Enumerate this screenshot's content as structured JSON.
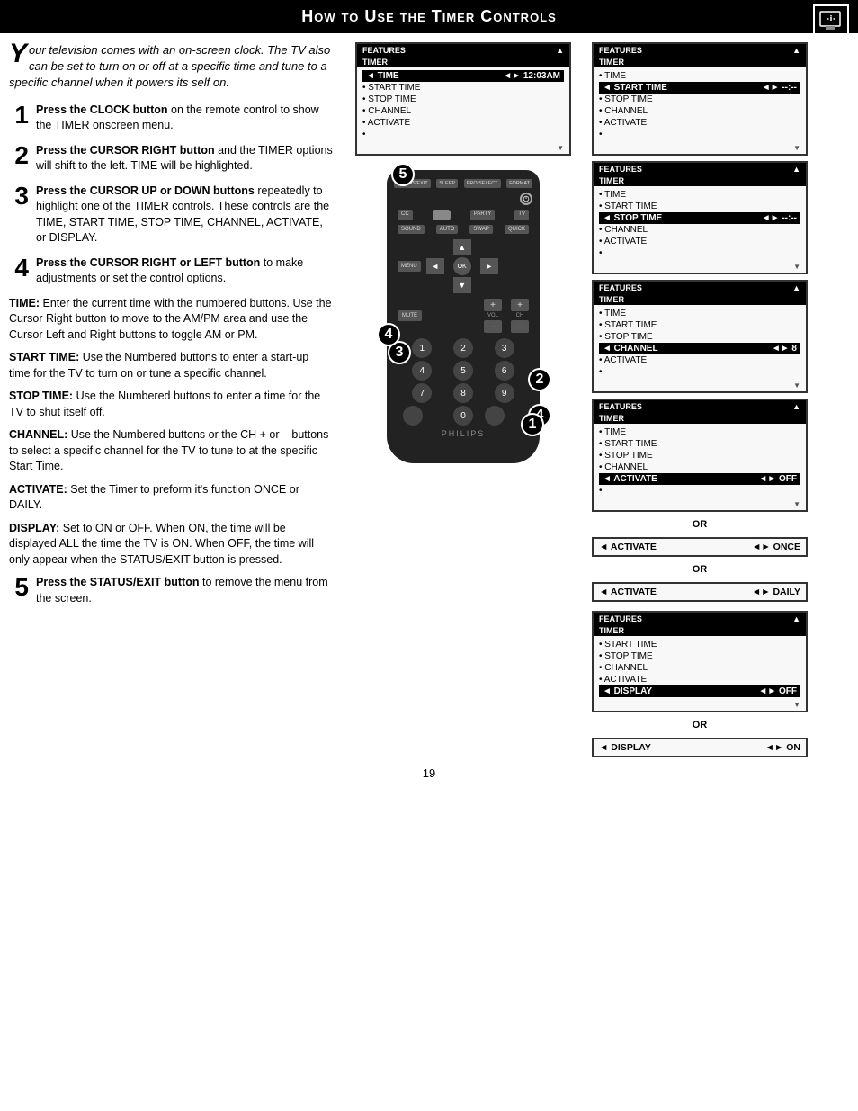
{
  "header": {
    "title": "How to Use the Timer Controls"
  },
  "intro": {
    "drop_cap": "Y",
    "text": "our television comes with an on-screen clock. The TV also can be set to turn on or off at a specific time and tune to a specific channel when it powers its self on."
  },
  "steps": [
    {
      "number": "1",
      "bold": "Press the CLOCK button",
      "text": " on the remote control to show the TIMER onscreen menu."
    },
    {
      "number": "2",
      "bold": "Press the CURSOR RIGHT button",
      "text": " and the TIMER options will shift to the left. TIME will be highlighted."
    },
    {
      "number": "3",
      "bold": "Press the CURSOR UP or DOWN buttons",
      "text": " repeatedly to highlight one of the TIMER controls. These controls are the TIME, START TIME, STOP TIME, CHANNEL, ACTIVATE, or DISPLAY."
    },
    {
      "number": "4",
      "bold": "Press the CURSOR RIGHT or LEFT button",
      "text": " to make adjustments or set the control options."
    }
  ],
  "descriptions": [
    {
      "label": "TIME:",
      "text": "Enter the current time with the numbered buttons. Use the Cursor Right button to move to the AM/PM area and use the Cursor Left and Right buttons to toggle AM or PM."
    },
    {
      "label": "START TIME:",
      "text": "Use the Numbered buttons to enter a start-up time for the TV to turn on or tune a specific channel."
    },
    {
      "label": "STOP TIME:",
      "text": "Use the Numbered buttons to enter a time for the TV to shut itself off."
    },
    {
      "label": "CHANNEL:",
      "text": "Use the Numbered buttons or the CH + or – buttons to select a specific channel for the TV to tune to at the specific Start Time."
    },
    {
      "label": "ACTIVATE:",
      "text": "Set the Timer to preform it's function ONCE or DAILY."
    },
    {
      "label": "DISPLAY:",
      "text": "Set to ON or OFF. When ON, the time will be displayed ALL the time the TV is ON. When OFF, the time will only appear when the STATUS/EXIT button is pressed."
    }
  ],
  "step5": {
    "number": "5",
    "bold": "Press the STATUS/EXIT button",
    "text": " to remove the menu from the screen."
  },
  "screens": {
    "screen1": {
      "header_left": "FEATURES",
      "header_arrow": "▲",
      "sub": "TIMER",
      "highlighted": "◄ TIME",
      "highlighted_right": "◄► 12:03AM",
      "items": [
        "• START TIME",
        "• STOP TIME",
        "• CHANNEL",
        "• ACTIVATE",
        "•"
      ],
      "footer": "▼"
    },
    "screen2": {
      "header_left": "FEATURES",
      "header_arrow": "▲",
      "sub": "TIMER",
      "items": [
        "• TIME"
      ],
      "highlighted": "◄ START TIME",
      "highlighted_right": "◄► --:--",
      "items2": [
        "• STOP TIME",
        "• CHANNEL",
        "• ACTIVATE",
        "•"
      ],
      "footer": "▼"
    },
    "screen3": {
      "header_left": "FEATURES",
      "header_arrow": "▲",
      "sub": "TIMER",
      "items": [
        "• TIME",
        "• START TIME"
      ],
      "highlighted": "◄ STOP TIME",
      "highlighted_right": "◄► --:--",
      "items2": [
        "• CHANNEL",
        "• ACTIVATE",
        "•"
      ],
      "footer": "▼"
    },
    "screen4": {
      "header_left": "FEATURES",
      "header_arrow": "▲",
      "sub": "TIMER",
      "items": [
        "• TIME",
        "• START TIME",
        "• STOP TIME"
      ],
      "highlighted": "◄ CHANNEL",
      "highlighted_right": "◄► 8",
      "items2": [
        "• ACTIVATE",
        "•"
      ],
      "footer": "▼"
    },
    "screen5": {
      "header_left": "FEATURES",
      "header_arrow": "▲",
      "sub": "TIMER",
      "items": [
        "• TIME",
        "• START TIME",
        "• STOP TIME",
        "• CHANNEL"
      ],
      "highlighted": "◄ ACTIVATE",
      "highlighted_right": "◄► OFF",
      "items2": [
        "•"
      ],
      "footer": "▼"
    },
    "screen5b": {
      "row1_left": "◄ ACTIVATE",
      "row1_right": "◄► ONCE"
    },
    "screen5c": {
      "row1_left": "◄ ACTIVATE",
      "row1_right": "◄► DAILY"
    },
    "screen6": {
      "header_left": "FEATURES",
      "header_arrow": "▲",
      "sub": "TIMER",
      "items": [
        "• START TIME",
        "• STOP TIME",
        "• CHANNEL",
        "• ACTIVATE"
      ],
      "highlighted": "◄ DISPLAY",
      "highlighted_right": "◄► OFF",
      "footer": "▼"
    },
    "screen6b": {
      "row1_left": "◄ DISPLAY",
      "row1_right": "◄► ON"
    }
  },
  "or_label": "OR",
  "page_number": "19",
  "remote": {
    "brand": "PHILIPS",
    "buttons": {
      "status_exit": "STATUS/EXIT",
      "sleep": "SLEEP",
      "pro_select": "PRO SELECT",
      "format": "FORMAT",
      "cc": "CC",
      "party": "PARTY",
      "tv": "TV",
      "sound": "SOUND",
      "auto": "AUTO",
      "swap": "SWAP",
      "quick": "QUICK",
      "menu": "MENU",
      "mute": "MUTE",
      "vol_up": "+",
      "vol_down": "–",
      "ch_up": "+",
      "ch_down": "–",
      "vol_label": "VOL",
      "ch_label": "CH",
      "numbers": [
        "1",
        "2",
        "3",
        "4",
        "5",
        "6",
        "7",
        "8",
        "9",
        "",
        "0",
        ""
      ]
    }
  }
}
